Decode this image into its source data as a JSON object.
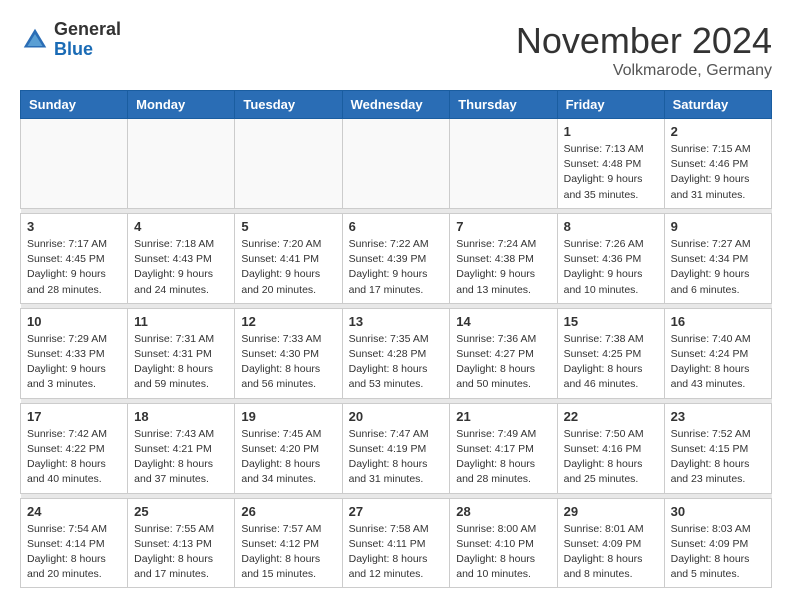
{
  "logo": {
    "general": "General",
    "blue": "Blue"
  },
  "header": {
    "month": "November 2024",
    "location": "Volkmarode, Germany"
  },
  "weekdays": [
    "Sunday",
    "Monday",
    "Tuesday",
    "Wednesday",
    "Thursday",
    "Friday",
    "Saturday"
  ],
  "weeks": [
    [
      {
        "day": "",
        "info": ""
      },
      {
        "day": "",
        "info": ""
      },
      {
        "day": "",
        "info": ""
      },
      {
        "day": "",
        "info": ""
      },
      {
        "day": "",
        "info": ""
      },
      {
        "day": "1",
        "info": "Sunrise: 7:13 AM\nSunset: 4:48 PM\nDaylight: 9 hours and 35 minutes."
      },
      {
        "day": "2",
        "info": "Sunrise: 7:15 AM\nSunset: 4:46 PM\nDaylight: 9 hours and 31 minutes."
      }
    ],
    [
      {
        "day": "3",
        "info": "Sunrise: 7:17 AM\nSunset: 4:45 PM\nDaylight: 9 hours and 28 minutes."
      },
      {
        "day": "4",
        "info": "Sunrise: 7:18 AM\nSunset: 4:43 PM\nDaylight: 9 hours and 24 minutes."
      },
      {
        "day": "5",
        "info": "Sunrise: 7:20 AM\nSunset: 4:41 PM\nDaylight: 9 hours and 20 minutes."
      },
      {
        "day": "6",
        "info": "Sunrise: 7:22 AM\nSunset: 4:39 PM\nDaylight: 9 hours and 17 minutes."
      },
      {
        "day": "7",
        "info": "Sunrise: 7:24 AM\nSunset: 4:38 PM\nDaylight: 9 hours and 13 minutes."
      },
      {
        "day": "8",
        "info": "Sunrise: 7:26 AM\nSunset: 4:36 PM\nDaylight: 9 hours and 10 minutes."
      },
      {
        "day": "9",
        "info": "Sunrise: 7:27 AM\nSunset: 4:34 PM\nDaylight: 9 hours and 6 minutes."
      }
    ],
    [
      {
        "day": "10",
        "info": "Sunrise: 7:29 AM\nSunset: 4:33 PM\nDaylight: 9 hours and 3 minutes."
      },
      {
        "day": "11",
        "info": "Sunrise: 7:31 AM\nSunset: 4:31 PM\nDaylight: 8 hours and 59 minutes."
      },
      {
        "day": "12",
        "info": "Sunrise: 7:33 AM\nSunset: 4:30 PM\nDaylight: 8 hours and 56 minutes."
      },
      {
        "day": "13",
        "info": "Sunrise: 7:35 AM\nSunset: 4:28 PM\nDaylight: 8 hours and 53 minutes."
      },
      {
        "day": "14",
        "info": "Sunrise: 7:36 AM\nSunset: 4:27 PM\nDaylight: 8 hours and 50 minutes."
      },
      {
        "day": "15",
        "info": "Sunrise: 7:38 AM\nSunset: 4:25 PM\nDaylight: 8 hours and 46 minutes."
      },
      {
        "day": "16",
        "info": "Sunrise: 7:40 AM\nSunset: 4:24 PM\nDaylight: 8 hours and 43 minutes."
      }
    ],
    [
      {
        "day": "17",
        "info": "Sunrise: 7:42 AM\nSunset: 4:22 PM\nDaylight: 8 hours and 40 minutes."
      },
      {
        "day": "18",
        "info": "Sunrise: 7:43 AM\nSunset: 4:21 PM\nDaylight: 8 hours and 37 minutes."
      },
      {
        "day": "19",
        "info": "Sunrise: 7:45 AM\nSunset: 4:20 PM\nDaylight: 8 hours and 34 minutes."
      },
      {
        "day": "20",
        "info": "Sunrise: 7:47 AM\nSunset: 4:19 PM\nDaylight: 8 hours and 31 minutes."
      },
      {
        "day": "21",
        "info": "Sunrise: 7:49 AM\nSunset: 4:17 PM\nDaylight: 8 hours and 28 minutes."
      },
      {
        "day": "22",
        "info": "Sunrise: 7:50 AM\nSunset: 4:16 PM\nDaylight: 8 hours and 25 minutes."
      },
      {
        "day": "23",
        "info": "Sunrise: 7:52 AM\nSunset: 4:15 PM\nDaylight: 8 hours and 23 minutes."
      }
    ],
    [
      {
        "day": "24",
        "info": "Sunrise: 7:54 AM\nSunset: 4:14 PM\nDaylight: 8 hours and 20 minutes."
      },
      {
        "day": "25",
        "info": "Sunrise: 7:55 AM\nSunset: 4:13 PM\nDaylight: 8 hours and 17 minutes."
      },
      {
        "day": "26",
        "info": "Sunrise: 7:57 AM\nSunset: 4:12 PM\nDaylight: 8 hours and 15 minutes."
      },
      {
        "day": "27",
        "info": "Sunrise: 7:58 AM\nSunset: 4:11 PM\nDaylight: 8 hours and 12 minutes."
      },
      {
        "day": "28",
        "info": "Sunrise: 8:00 AM\nSunset: 4:10 PM\nDaylight: 8 hours and 10 minutes."
      },
      {
        "day": "29",
        "info": "Sunrise: 8:01 AM\nSunset: 4:09 PM\nDaylight: 8 hours and 8 minutes."
      },
      {
        "day": "30",
        "info": "Sunrise: 8:03 AM\nSunset: 4:09 PM\nDaylight: 8 hours and 5 minutes."
      }
    ]
  ]
}
